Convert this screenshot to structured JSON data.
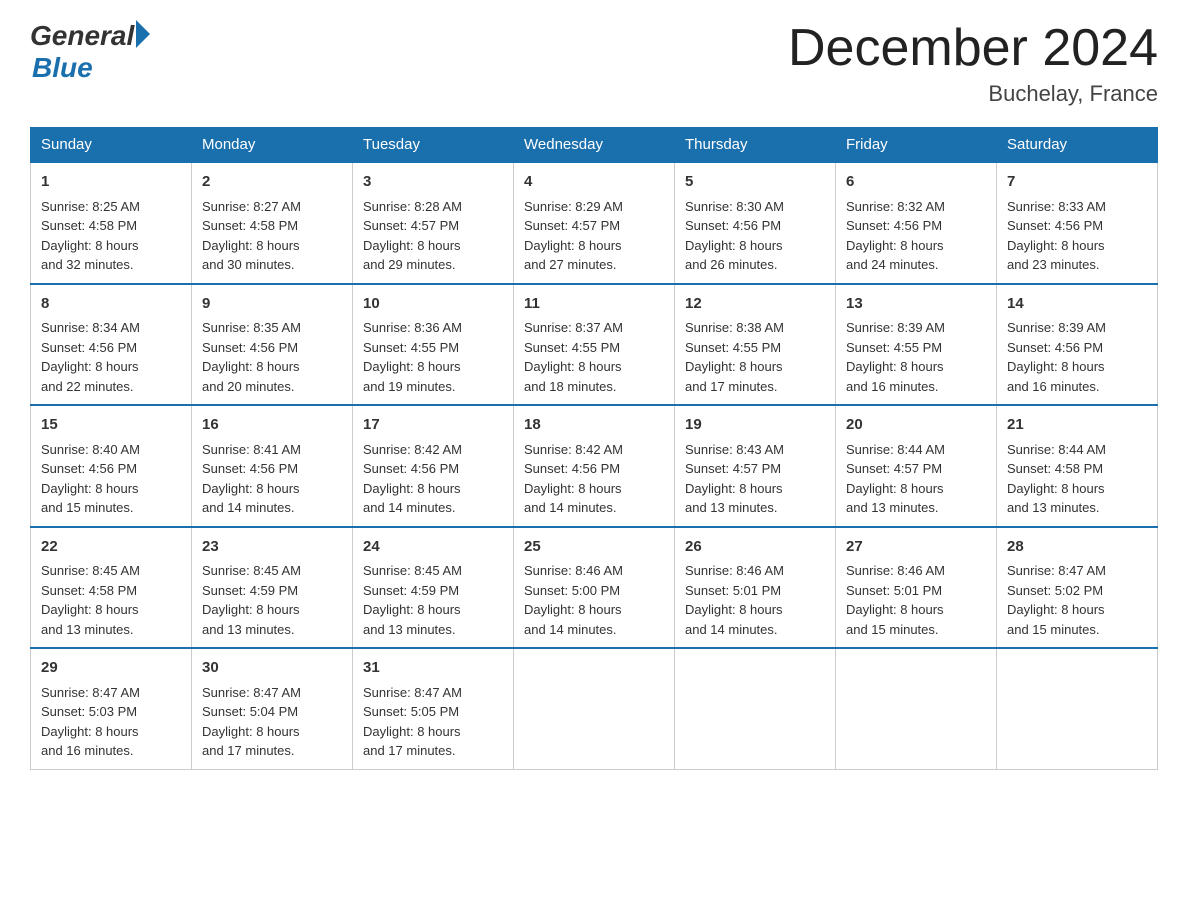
{
  "header": {
    "logo_general": "General",
    "logo_blue": "Blue",
    "month_title": "December 2024",
    "location": "Buchelay, France"
  },
  "days_of_week": [
    "Sunday",
    "Monday",
    "Tuesday",
    "Wednesday",
    "Thursday",
    "Friday",
    "Saturday"
  ],
  "weeks": [
    [
      {
        "day": "1",
        "sunrise": "8:25 AM",
        "sunset": "4:58 PM",
        "daylight": "8 hours and 32 minutes."
      },
      {
        "day": "2",
        "sunrise": "8:27 AM",
        "sunset": "4:58 PM",
        "daylight": "8 hours and 30 minutes."
      },
      {
        "day": "3",
        "sunrise": "8:28 AM",
        "sunset": "4:57 PM",
        "daylight": "8 hours and 29 minutes."
      },
      {
        "day": "4",
        "sunrise": "8:29 AM",
        "sunset": "4:57 PM",
        "daylight": "8 hours and 27 minutes."
      },
      {
        "day": "5",
        "sunrise": "8:30 AM",
        "sunset": "4:56 PM",
        "daylight": "8 hours and 26 minutes."
      },
      {
        "day": "6",
        "sunrise": "8:32 AM",
        "sunset": "4:56 PM",
        "daylight": "8 hours and 24 minutes."
      },
      {
        "day": "7",
        "sunrise": "8:33 AM",
        "sunset": "4:56 PM",
        "daylight": "8 hours and 23 minutes."
      }
    ],
    [
      {
        "day": "8",
        "sunrise": "8:34 AM",
        "sunset": "4:56 PM",
        "daylight": "8 hours and 22 minutes."
      },
      {
        "day": "9",
        "sunrise": "8:35 AM",
        "sunset": "4:56 PM",
        "daylight": "8 hours and 20 minutes."
      },
      {
        "day": "10",
        "sunrise": "8:36 AM",
        "sunset": "4:55 PM",
        "daylight": "8 hours and 19 minutes."
      },
      {
        "day": "11",
        "sunrise": "8:37 AM",
        "sunset": "4:55 PM",
        "daylight": "8 hours and 18 minutes."
      },
      {
        "day": "12",
        "sunrise": "8:38 AM",
        "sunset": "4:55 PM",
        "daylight": "8 hours and 17 minutes."
      },
      {
        "day": "13",
        "sunrise": "8:39 AM",
        "sunset": "4:55 PM",
        "daylight": "8 hours and 16 minutes."
      },
      {
        "day": "14",
        "sunrise": "8:39 AM",
        "sunset": "4:56 PM",
        "daylight": "8 hours and 16 minutes."
      }
    ],
    [
      {
        "day": "15",
        "sunrise": "8:40 AM",
        "sunset": "4:56 PM",
        "daylight": "8 hours and 15 minutes."
      },
      {
        "day": "16",
        "sunrise": "8:41 AM",
        "sunset": "4:56 PM",
        "daylight": "8 hours and 14 minutes."
      },
      {
        "day": "17",
        "sunrise": "8:42 AM",
        "sunset": "4:56 PM",
        "daylight": "8 hours and 14 minutes."
      },
      {
        "day": "18",
        "sunrise": "8:42 AM",
        "sunset": "4:56 PM",
        "daylight": "8 hours and 14 minutes."
      },
      {
        "day": "19",
        "sunrise": "8:43 AM",
        "sunset": "4:57 PM",
        "daylight": "8 hours and 13 minutes."
      },
      {
        "day": "20",
        "sunrise": "8:44 AM",
        "sunset": "4:57 PM",
        "daylight": "8 hours and 13 minutes."
      },
      {
        "day": "21",
        "sunrise": "8:44 AM",
        "sunset": "4:58 PM",
        "daylight": "8 hours and 13 minutes."
      }
    ],
    [
      {
        "day": "22",
        "sunrise": "8:45 AM",
        "sunset": "4:58 PM",
        "daylight": "8 hours and 13 minutes."
      },
      {
        "day": "23",
        "sunrise": "8:45 AM",
        "sunset": "4:59 PM",
        "daylight": "8 hours and 13 minutes."
      },
      {
        "day": "24",
        "sunrise": "8:45 AM",
        "sunset": "4:59 PM",
        "daylight": "8 hours and 13 minutes."
      },
      {
        "day": "25",
        "sunrise": "8:46 AM",
        "sunset": "5:00 PM",
        "daylight": "8 hours and 14 minutes."
      },
      {
        "day": "26",
        "sunrise": "8:46 AM",
        "sunset": "5:01 PM",
        "daylight": "8 hours and 14 minutes."
      },
      {
        "day": "27",
        "sunrise": "8:46 AM",
        "sunset": "5:01 PM",
        "daylight": "8 hours and 15 minutes."
      },
      {
        "day": "28",
        "sunrise": "8:47 AM",
        "sunset": "5:02 PM",
        "daylight": "8 hours and 15 minutes."
      }
    ],
    [
      {
        "day": "29",
        "sunrise": "8:47 AM",
        "sunset": "5:03 PM",
        "daylight": "8 hours and 16 minutes."
      },
      {
        "day": "30",
        "sunrise": "8:47 AM",
        "sunset": "5:04 PM",
        "daylight": "8 hours and 17 minutes."
      },
      {
        "day": "31",
        "sunrise": "8:47 AM",
        "sunset": "5:05 PM",
        "daylight": "8 hours and 17 minutes."
      },
      null,
      null,
      null,
      null
    ]
  ],
  "labels": {
    "sunrise": "Sunrise:",
    "sunset": "Sunset:",
    "daylight": "Daylight:"
  }
}
